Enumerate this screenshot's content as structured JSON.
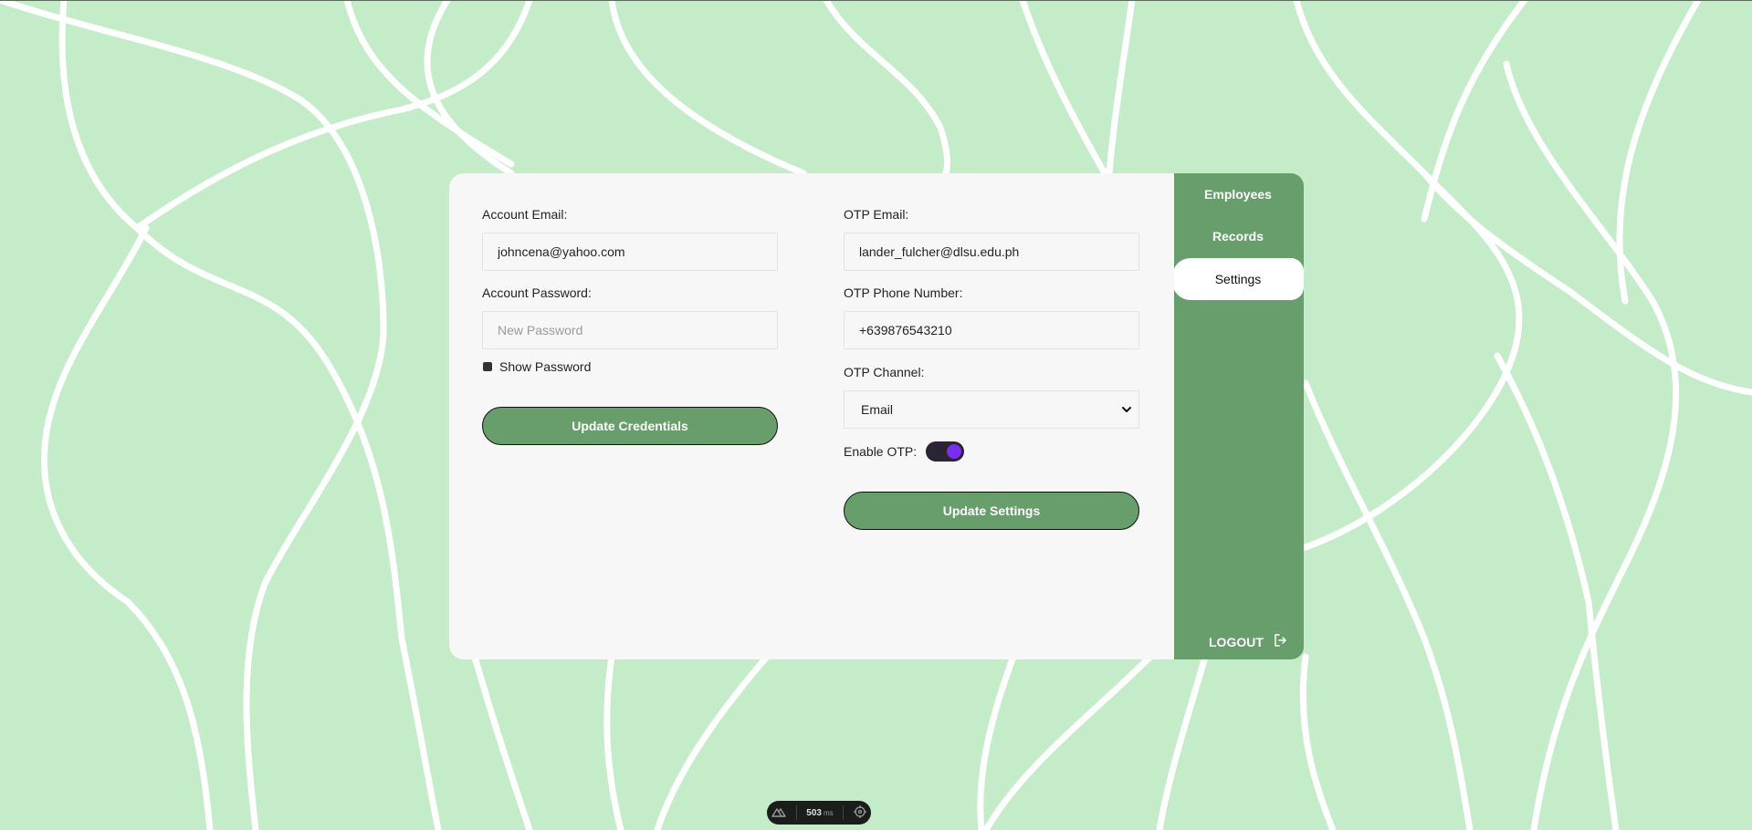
{
  "settings": {
    "account_email_label": "Account Email:",
    "account_email_value": "johncena@yahoo.com",
    "account_password_label": "Account Password:",
    "account_password_placeholder": "New Password",
    "show_password_label": "Show Password",
    "update_credentials_label": "Update Credentials",
    "otp_email_label": "OTP Email:",
    "otp_email_value": "lander_fulcher@dlsu.edu.ph",
    "otp_phone_label": "OTP Phone Number:",
    "otp_phone_value": "+639876543210",
    "otp_channel_label": "OTP Channel:",
    "otp_channel_selected": "Email",
    "enable_otp_label": "Enable OTP:",
    "enable_otp_on": true,
    "update_settings_label": "Update Settings"
  },
  "sidebar": {
    "items": [
      {
        "label": "Employees",
        "active": false
      },
      {
        "label": "Records",
        "active": false
      },
      {
        "label": "Settings",
        "active": true
      }
    ],
    "logout_label": "LOGOUT"
  },
  "devbar": {
    "time_value": "503",
    "time_unit": "ms"
  },
  "colors": {
    "background": "#c5ecc9",
    "card": "#f7f7f7",
    "accent": "#689d6c",
    "toggle_knob": "#7a2ff0"
  }
}
